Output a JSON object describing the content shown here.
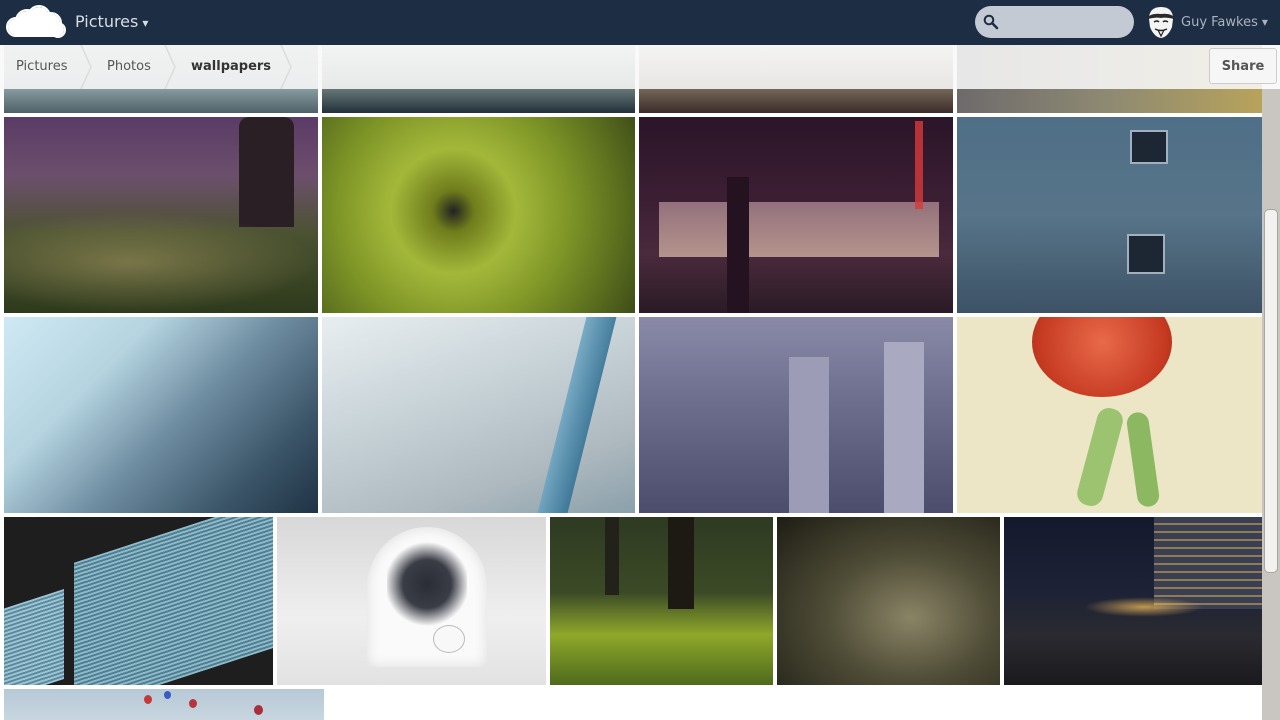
{
  "header": {
    "app_name": "Pictures",
    "app_caret": "▾",
    "search_placeholder": "",
    "user_name": "Guy Fawkes",
    "user_caret": "▾",
    "bg_color": "#1d2d44"
  },
  "breadcrumb": {
    "items": [
      "Pictures",
      "Photos",
      "wallpapers"
    ],
    "share_label": "Share"
  },
  "gallery": {
    "photos": [
      "photo-1",
      "photo-2",
      "photo-3",
      "photo-4",
      "purple-trees",
      "green-chrysanthemum",
      "hotel-barcelona-night",
      "concrete-wall",
      "glass-building-curve",
      "white-facade",
      "blue-columns-building",
      "tomato-noodles",
      "striped-blinds",
      "flower-vase-alcove",
      "forest-grass",
      "rainy-water",
      "night-city",
      "balloons-sky"
    ]
  }
}
